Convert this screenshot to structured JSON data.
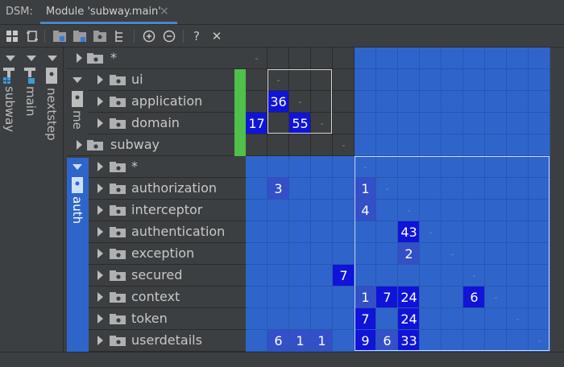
{
  "title_label": "DSM:",
  "tab": {
    "label": "Module 'subway.main'",
    "close": "×"
  },
  "toolbar": {
    "buttons": [
      "expand-all-icon",
      "flip-icon",
      "package-icon",
      "package-folder-icon",
      "folder-icon",
      "structure-icon",
      "zoom-in-icon",
      "zoom-out-icon",
      "help-icon",
      "close-icon"
    ],
    "help_label": "?",
    "close_label": "✕"
  },
  "tree": {
    "columns": [
      {
        "label": "subway"
      },
      {
        "label": "main"
      },
      {
        "label": "nextstep"
      },
      {
        "label": "me"
      },
      {
        "label": "auth"
      }
    ],
    "rows": [
      {
        "label": "*"
      },
      {
        "label": "ui"
      },
      {
        "label": "application"
      },
      {
        "label": "domain"
      },
      {
        "label": "subway"
      },
      {
        "label": "*"
      },
      {
        "label": "authorization"
      },
      {
        "label": "interceptor"
      },
      {
        "label": "authentication"
      },
      {
        "label": "exception"
      },
      {
        "label": "secured"
      },
      {
        "label": "context"
      },
      {
        "label": "token"
      },
      {
        "label": "userdetails"
      }
    ]
  },
  "matrix": {
    "columns": 14,
    "cells": [
      {
        "row": 0,
        "col": 0,
        "value": "-"
      },
      {
        "row": 1,
        "col": 1,
        "value": "-"
      },
      {
        "row": 2,
        "col": 1,
        "value": "36"
      },
      {
        "row": 2,
        "col": 2,
        "value": "-"
      },
      {
        "row": 3,
        "col": 0,
        "value": "17"
      },
      {
        "row": 3,
        "col": 2,
        "value": "55"
      },
      {
        "row": 3,
        "col": 3,
        "value": "-"
      },
      {
        "row": 4,
        "col": 4,
        "value": "-"
      },
      {
        "row": 5,
        "col": 5,
        "value": "-"
      },
      {
        "row": 6,
        "col": 1,
        "value": "3"
      },
      {
        "row": 6,
        "col": 5,
        "value": "1"
      },
      {
        "row": 6,
        "col": 6,
        "value": "-"
      },
      {
        "row": 7,
        "col": 5,
        "value": "4"
      },
      {
        "row": 7,
        "col": 7,
        "value": "-"
      },
      {
        "row": 8,
        "col": 7,
        "value": "43"
      },
      {
        "row": 8,
        "col": 8,
        "value": "-"
      },
      {
        "row": 9,
        "col": 7,
        "value": "2"
      },
      {
        "row": 9,
        "col": 9,
        "value": "-"
      },
      {
        "row": 10,
        "col": 4,
        "value": "7"
      },
      {
        "row": 10,
        "col": 10,
        "value": "-"
      },
      {
        "row": 11,
        "col": 5,
        "value": "1"
      },
      {
        "row": 11,
        "col": 6,
        "value": "7"
      },
      {
        "row": 11,
        "col": 7,
        "value": "24"
      },
      {
        "row": 11,
        "col": 10,
        "value": "6"
      },
      {
        "row": 11,
        "col": 11,
        "value": "-"
      },
      {
        "row": 12,
        "col": 5,
        "value": "7"
      },
      {
        "row": 12,
        "col": 7,
        "value": "24"
      },
      {
        "row": 12,
        "col": 12,
        "value": "-"
      },
      {
        "row": 13,
        "col": 1,
        "value": "6"
      },
      {
        "row": 13,
        "col": 2,
        "value": "1"
      },
      {
        "row": 13,
        "col": 3,
        "value": "1"
      },
      {
        "row": 13,
        "col": 5,
        "value": "9"
      },
      {
        "row": 13,
        "col": 6,
        "value": "6"
      },
      {
        "row": 13,
        "col": 7,
        "value": "33"
      },
      {
        "row": 13,
        "col": 13,
        "value": "-"
      }
    ]
  },
  "colors": {
    "dark_bg": "#3c3f41",
    "matrix_blue": "#2f65ca",
    "strong_blue": "#0f14d8",
    "medium_blue": "#3350c8",
    "accent_green": "#4fc04a"
  }
}
